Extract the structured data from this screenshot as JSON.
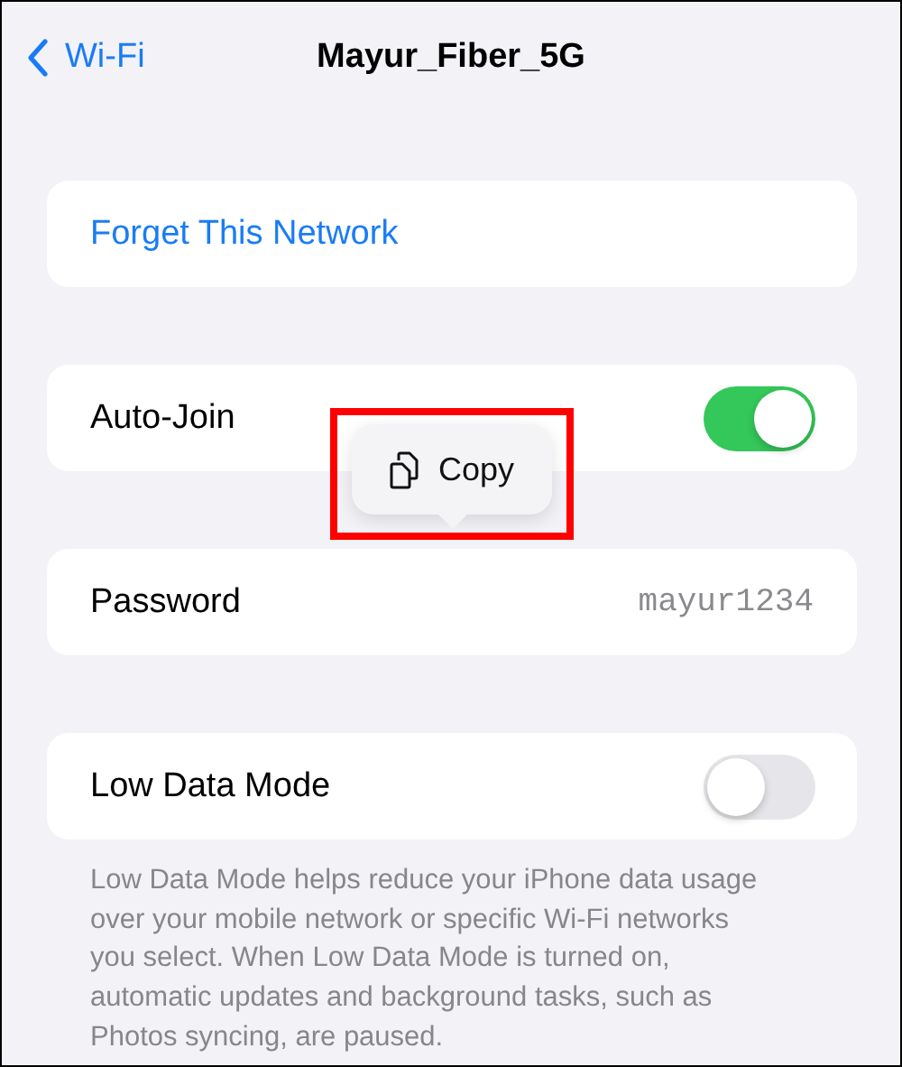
{
  "nav": {
    "back_label": "Wi-Fi",
    "title": "Mayur_Fiber_5G"
  },
  "rows": [
    {
      "kind": "action",
      "label": "Forget This Network"
    },
    {
      "kind": "toggle",
      "label": "Auto-Join",
      "on": true
    },
    {
      "kind": "value",
      "label": "Password",
      "value": "mayur1234"
    },
    {
      "kind": "toggle",
      "label": "Low Data Mode",
      "on": false
    }
  ],
  "footer_note": "Low Data Mode helps reduce your iPhone data usage over your mobile network or specific Wi-Fi networks you select. When Low Data Mode is turned on, automatic updates and background tasks, such as Photos syncing, are paused.",
  "popup": {
    "label": "Copy",
    "highlighted": true
  }
}
